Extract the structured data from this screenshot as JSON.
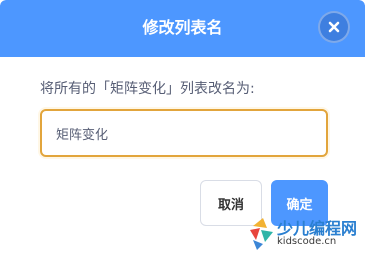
{
  "dialog": {
    "title": "修改列表名",
    "close_icon": "close-icon",
    "prompt": "将所有的「矩阵变化」列表改名为:",
    "input_value": "矩阵变化",
    "cancel_label": "取消",
    "ok_label": "确定"
  },
  "colors": {
    "header": "#4d97ff",
    "input_border": "#e2a53c",
    "ok_button": "#4d97ff"
  },
  "watermark": {
    "line1": "少儿编程网",
    "line2": "kidscode.cn"
  }
}
